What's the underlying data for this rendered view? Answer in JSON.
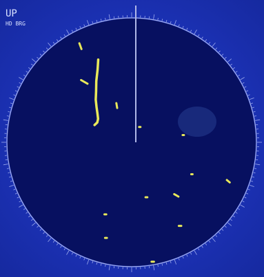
{
  "header": {
    "mode_label": "UP",
    "sub_label": "HD BRG"
  },
  "colors": {
    "background": "#1d33b8",
    "scope": "#071060",
    "ring": "#c8d2ff",
    "echo": "#e8e85a",
    "heading_line": "#b0b8e8",
    "text": "#d8e0ff"
  },
  "bearing_ring": {
    "start_deg": 0,
    "end_deg": 350,
    "step_deg": 10
  },
  "echoes": [
    {
      "az": -28,
      "r": 0.88,
      "len": 0.05,
      "ang": 70
    },
    {
      "az": -38,
      "r": 0.62,
      "len": 0.06,
      "ang": 30
    },
    {
      "az": -22,
      "r": 0.32,
      "len": 0.04,
      "ang": 80
    },
    {
      "az": 28,
      "r": 0.14,
      "len": 0.01,
      "ang": 0
    },
    {
      "az": 82,
      "r": 0.42,
      "len": 0.01,
      "ang": 0
    },
    {
      "az": 118,
      "r": 0.55,
      "len": 0.01,
      "ang": 0
    },
    {
      "az": 112,
      "r": 0.84,
      "len": 0.03,
      "ang": 40
    },
    {
      "az": 140,
      "r": 0.56,
      "len": 0.04,
      "ang": 30
    },
    {
      "az": 150,
      "r": 0.78,
      "len": 0.02,
      "ang": 0
    },
    {
      "az": 165,
      "r": 0.46,
      "len": 0.015,
      "ang": 0
    },
    {
      "az": 170,
      "r": 0.98,
      "len": 0.02,
      "ang": 0
    },
    {
      "az": 195,
      "r": 0.8,
      "len": 0.015,
      "ang": 0
    },
    {
      "az": 200,
      "r": 0.62,
      "len": 0.015,
      "ang": 0
    }
  ],
  "coastline": [
    [
      -65,
      0.33
    ],
    [
      -60,
      0.32
    ],
    [
      -55,
      0.33
    ],
    [
      -50,
      0.36
    ],
    [
      -45,
      0.4
    ],
    [
      -40,
      0.45
    ],
    [
      -35,
      0.5
    ],
    [
      -30,
      0.57
    ],
    [
      -25,
      0.65
    ],
    [
      -22,
      0.72
    ]
  ]
}
